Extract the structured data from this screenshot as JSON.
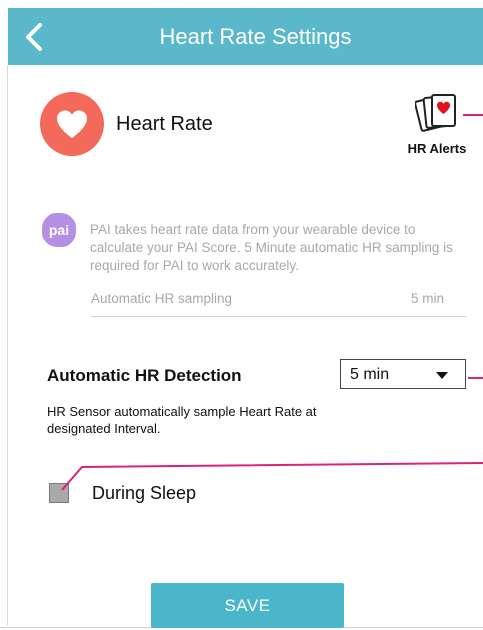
{
  "header": {
    "title": "Heart Rate Settings"
  },
  "heart_rate": {
    "label": "Heart Rate"
  },
  "hr_alerts": {
    "label": "HR Alerts"
  },
  "pai": {
    "badge": "pai",
    "description": "PAI takes heart rate data from your wearable device to calculate your PAI Score. 5 Minute automatic HR sampling is required for PAI to work accurately.",
    "sampling_label": "Automatic HR sampling",
    "sampling_value": "5 min"
  },
  "detection": {
    "label": "Automatic HR Detection",
    "selected": "5 min",
    "description": "HR Sensor automatically sample Heart Rate at designated Interval."
  },
  "sleep": {
    "label": "During Sleep",
    "checked": true
  },
  "save_label": "SAVE",
  "colors": {
    "header": "#5bb8cb",
    "heart": "#f36a5a",
    "pai": "#b58ee6",
    "save": "#4bb6ca",
    "callout": "#d8247d"
  }
}
